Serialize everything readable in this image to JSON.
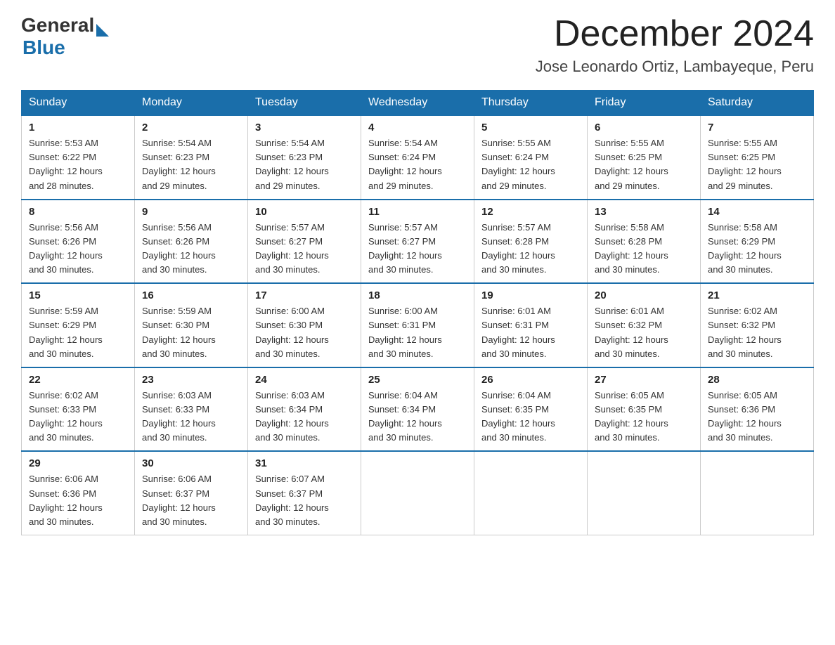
{
  "header": {
    "logo_general": "General",
    "logo_blue": "Blue",
    "month_title": "December 2024",
    "location": "Jose Leonardo Ortiz, Lambayeque, Peru"
  },
  "days_of_week": [
    "Sunday",
    "Monday",
    "Tuesday",
    "Wednesday",
    "Thursday",
    "Friday",
    "Saturday"
  ],
  "weeks": [
    [
      {
        "day": "1",
        "sunrise": "5:53 AM",
        "sunset": "6:22 PM",
        "daylight": "12 hours and 28 minutes."
      },
      {
        "day": "2",
        "sunrise": "5:54 AM",
        "sunset": "6:23 PM",
        "daylight": "12 hours and 29 minutes."
      },
      {
        "day": "3",
        "sunrise": "5:54 AM",
        "sunset": "6:23 PM",
        "daylight": "12 hours and 29 minutes."
      },
      {
        "day": "4",
        "sunrise": "5:54 AM",
        "sunset": "6:24 PM",
        "daylight": "12 hours and 29 minutes."
      },
      {
        "day": "5",
        "sunrise": "5:55 AM",
        "sunset": "6:24 PM",
        "daylight": "12 hours and 29 minutes."
      },
      {
        "day": "6",
        "sunrise": "5:55 AM",
        "sunset": "6:25 PM",
        "daylight": "12 hours and 29 minutes."
      },
      {
        "day": "7",
        "sunrise": "5:55 AM",
        "sunset": "6:25 PM",
        "daylight": "12 hours and 29 minutes."
      }
    ],
    [
      {
        "day": "8",
        "sunrise": "5:56 AM",
        "sunset": "6:26 PM",
        "daylight": "12 hours and 30 minutes."
      },
      {
        "day": "9",
        "sunrise": "5:56 AM",
        "sunset": "6:26 PM",
        "daylight": "12 hours and 30 minutes."
      },
      {
        "day": "10",
        "sunrise": "5:57 AM",
        "sunset": "6:27 PM",
        "daylight": "12 hours and 30 minutes."
      },
      {
        "day": "11",
        "sunrise": "5:57 AM",
        "sunset": "6:27 PM",
        "daylight": "12 hours and 30 minutes."
      },
      {
        "day": "12",
        "sunrise": "5:57 AM",
        "sunset": "6:28 PM",
        "daylight": "12 hours and 30 minutes."
      },
      {
        "day": "13",
        "sunrise": "5:58 AM",
        "sunset": "6:28 PM",
        "daylight": "12 hours and 30 minutes."
      },
      {
        "day": "14",
        "sunrise": "5:58 AM",
        "sunset": "6:29 PM",
        "daylight": "12 hours and 30 minutes."
      }
    ],
    [
      {
        "day": "15",
        "sunrise": "5:59 AM",
        "sunset": "6:29 PM",
        "daylight": "12 hours and 30 minutes."
      },
      {
        "day": "16",
        "sunrise": "5:59 AM",
        "sunset": "6:30 PM",
        "daylight": "12 hours and 30 minutes."
      },
      {
        "day": "17",
        "sunrise": "6:00 AM",
        "sunset": "6:30 PM",
        "daylight": "12 hours and 30 minutes."
      },
      {
        "day": "18",
        "sunrise": "6:00 AM",
        "sunset": "6:31 PM",
        "daylight": "12 hours and 30 minutes."
      },
      {
        "day": "19",
        "sunrise": "6:01 AM",
        "sunset": "6:31 PM",
        "daylight": "12 hours and 30 minutes."
      },
      {
        "day": "20",
        "sunrise": "6:01 AM",
        "sunset": "6:32 PM",
        "daylight": "12 hours and 30 minutes."
      },
      {
        "day": "21",
        "sunrise": "6:02 AM",
        "sunset": "6:32 PM",
        "daylight": "12 hours and 30 minutes."
      }
    ],
    [
      {
        "day": "22",
        "sunrise": "6:02 AM",
        "sunset": "6:33 PM",
        "daylight": "12 hours and 30 minutes."
      },
      {
        "day": "23",
        "sunrise": "6:03 AM",
        "sunset": "6:33 PM",
        "daylight": "12 hours and 30 minutes."
      },
      {
        "day": "24",
        "sunrise": "6:03 AM",
        "sunset": "6:34 PM",
        "daylight": "12 hours and 30 minutes."
      },
      {
        "day": "25",
        "sunrise": "6:04 AM",
        "sunset": "6:34 PM",
        "daylight": "12 hours and 30 minutes."
      },
      {
        "day": "26",
        "sunrise": "6:04 AM",
        "sunset": "6:35 PM",
        "daylight": "12 hours and 30 minutes."
      },
      {
        "day": "27",
        "sunrise": "6:05 AM",
        "sunset": "6:35 PM",
        "daylight": "12 hours and 30 minutes."
      },
      {
        "day": "28",
        "sunrise": "6:05 AM",
        "sunset": "6:36 PM",
        "daylight": "12 hours and 30 minutes."
      }
    ],
    [
      {
        "day": "29",
        "sunrise": "6:06 AM",
        "sunset": "6:36 PM",
        "daylight": "12 hours and 30 minutes."
      },
      {
        "day": "30",
        "sunrise": "6:06 AM",
        "sunset": "6:37 PM",
        "daylight": "12 hours and 30 minutes."
      },
      {
        "day": "31",
        "sunrise": "6:07 AM",
        "sunset": "6:37 PM",
        "daylight": "12 hours and 30 minutes."
      },
      null,
      null,
      null,
      null
    ]
  ],
  "labels": {
    "sunrise": "Sunrise:",
    "sunset": "Sunset:",
    "daylight": "Daylight:"
  }
}
